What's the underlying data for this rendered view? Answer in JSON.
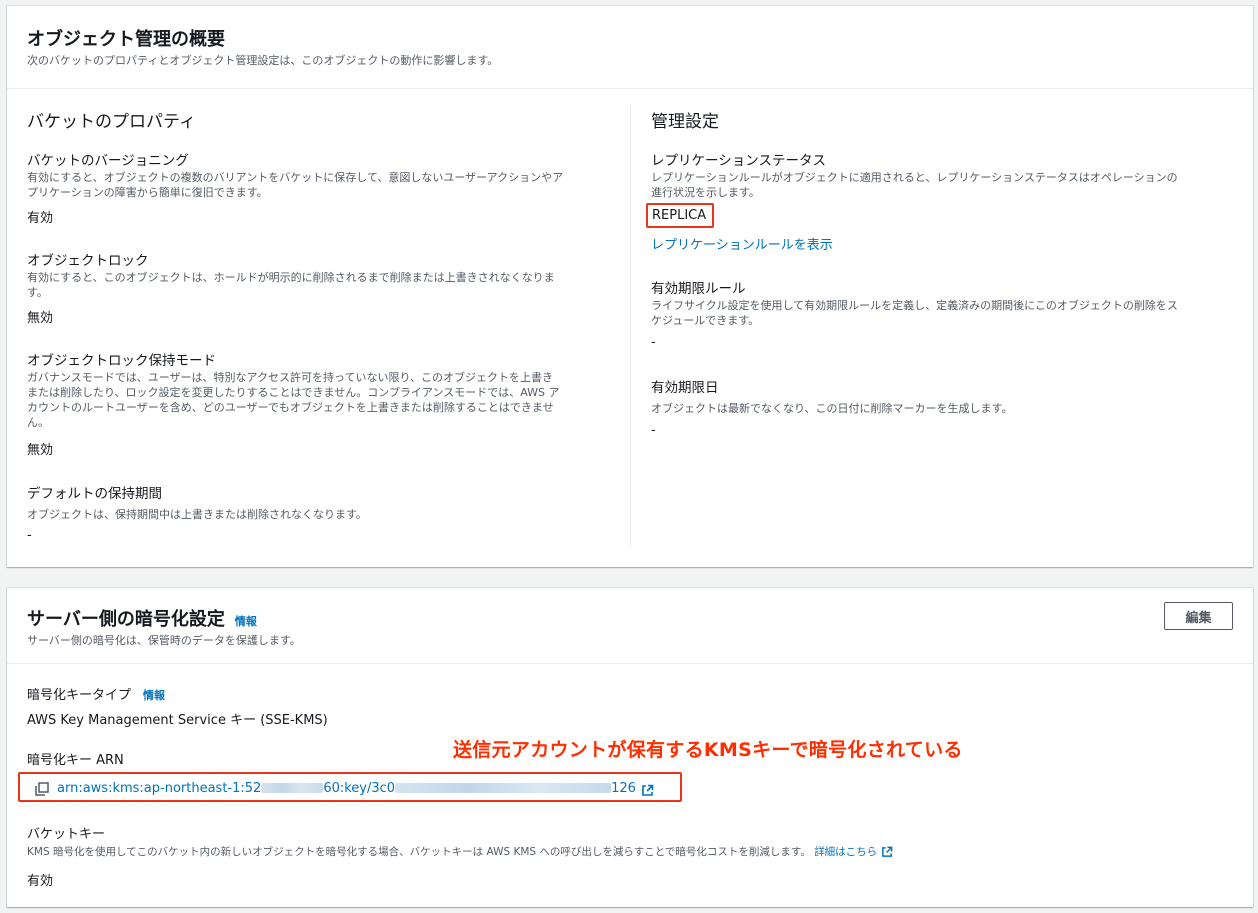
{
  "overview": {
    "title": "オブジェクト管理の概要",
    "description": "次のバケットのプロパティとオブジェクト管理設定は、このオブジェクトの動作に影響します。",
    "bucket_props": {
      "title": "バケットのプロパティ",
      "versioning": {
        "label": "バケットのバージョニング",
        "desc_line1": "有効にすると、オブジェクトの複数のバリアントをバケットに保存して、意図しないユーザーアクションやア",
        "desc_line2": "プリケーションの障害から簡単に復旧できます。",
        "value": "有効"
      },
      "object_lock": {
        "label": "オブジェクトロック",
        "desc_line1": "有効にすると、このオブジェクトは、ホールドが明示的に削除されるまで削除または上書きされなくなりま",
        "desc_line2": "す。",
        "value": "無効"
      },
      "lock_mode": {
        "label": "オブジェクトロック保持モード",
        "desc_line1": "ガバナンスモードでは、ユーザーは、特別なアクセス許可を持っていない限り、このオブジェクトを上書き",
        "desc_line2": "または削除したり、ロック設定を変更したりすることはできません。コンプライアンスモードでは、AWS ア",
        "desc_line3": "カウントのルートユーザーを含め、どのユーザーでもオブジェクトを上書きまたは削除することはできませ",
        "desc_line4": "ん。",
        "value": "無効"
      },
      "retention": {
        "label": "デフォルトの保持期間",
        "desc": "オブジェクトは、保持期間中は上書きまたは削除されなくなります。",
        "value": "-"
      }
    },
    "mgmt": {
      "title": "管理設定",
      "replication_status": {
        "label": "レプリケーションステータス",
        "desc_line1": "レプリケーションルールがオブジェクトに適用されると、レプリケーションステータスはオペレーションの",
        "desc_line2": "進行状況を示します。",
        "value": "REPLICA",
        "rule_link": "レプリケーションルールを表示"
      },
      "expiration_rule": {
        "label": "有効期限ルール",
        "desc_line1": "ライフサイクル設定を使用して有効期限ルールを定義し、定義済みの期間後にこのオブジェクトの削除をス",
        "desc_line2": "ケジュールできます。",
        "value": "-"
      },
      "expiration_date": {
        "label": "有効期限日",
        "desc": "オブジェクトは最新でなくなり、この日付に削除マーカーを生成します。",
        "value": "-"
      }
    }
  },
  "encryption": {
    "title": "サーバー側の暗号化設定",
    "info": "情報",
    "description": "サーバー側の暗号化は、保管時のデータを保護します。",
    "edit_button": "編集",
    "key_type": {
      "label": "暗号化キータイプ",
      "info": "情報",
      "value": "AWS Key Management Service キー (SSE-KMS)"
    },
    "key_arn": {
      "label": "暗号化キー ARN",
      "arn_part1": "arn:aws:kms:ap-northeast-1:52",
      "arn_part2": "60:key/3c0",
      "arn_part3": "126"
    },
    "bucket_key": {
      "label": "バケットキー",
      "desc": "KMS 暗号化を使用してこのバケット内の新しいオブジェクトを暗号化する場合、バケットキーは AWS KMS への呼び出しを減らすことで暗号化コストを削減します。",
      "details_link": "詳細はこちら",
      "value": "有効"
    },
    "annotation": "送信元アカウントが保有するKMSキーで暗号化されている"
  },
  "colors": {
    "link": "#0073bb",
    "annotation": "#ff2e00",
    "highlight_border": "#e8351b"
  }
}
